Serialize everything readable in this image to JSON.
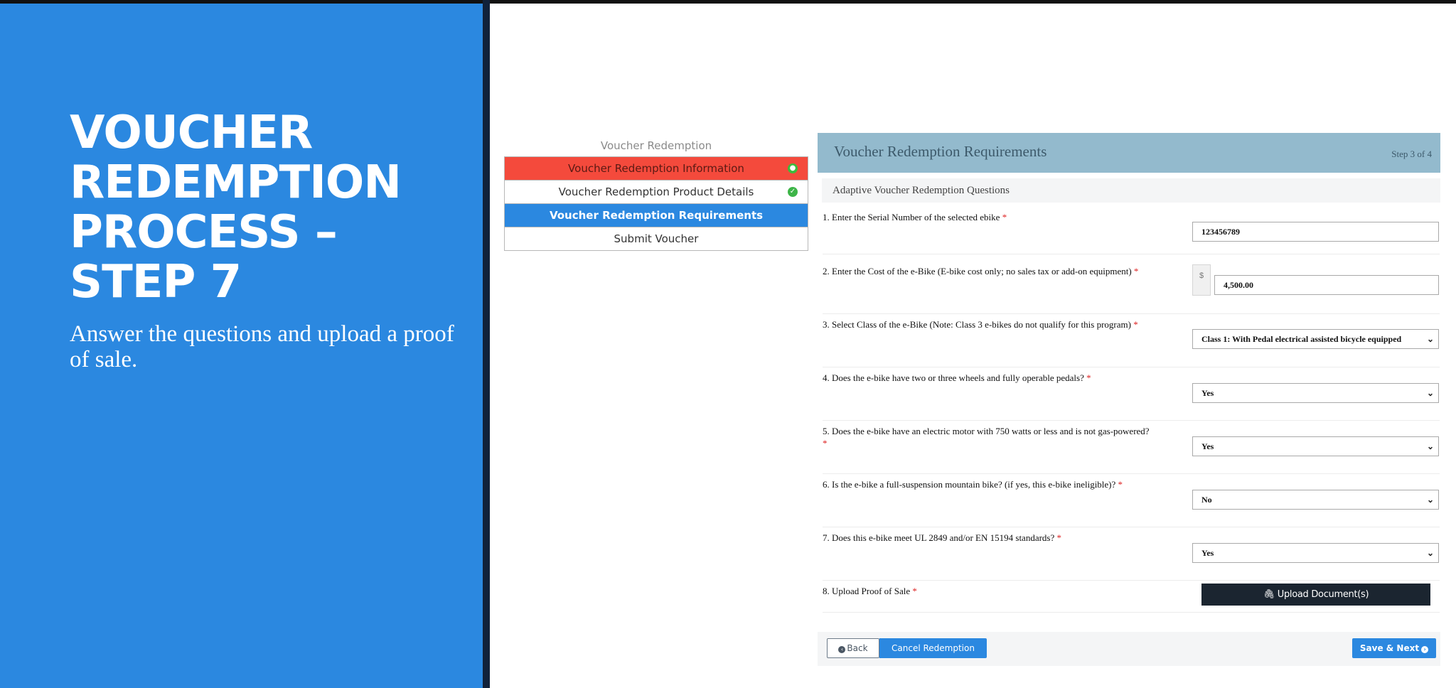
{
  "slide": {
    "title_lines": [
      "VOUCHER",
      "REDEMPTION",
      "PROCESS –",
      "STEP 7"
    ],
    "subtitle": "Answer the questions and upload a proof of sale."
  },
  "steps_nav": {
    "header": "Voucher Redemption",
    "items": [
      {
        "label": "Voucher Redemption Information",
        "state": "error",
        "check": "●"
      },
      {
        "label": "Voucher Redemption Product Details",
        "state": "complete",
        "check": "✓"
      },
      {
        "label": "Voucher Redemption Requirements",
        "state": "active"
      },
      {
        "label": "Submit Voucher",
        "state": "pending"
      }
    ]
  },
  "form": {
    "title": "Voucher Redemption Requirements",
    "step_indicator": "Step 3 of 4",
    "section_title": "Adaptive Voucher Redemption Questions",
    "currency_symbol": "$",
    "questions": [
      {
        "label": "1. Enter the Serial Number of the selected ebike",
        "value": "123456789"
      },
      {
        "label": "2. Enter the Cost of the e-Bike (E-bike cost only; no sales tax or add-on equipment)",
        "value": "4,500.00"
      },
      {
        "label": "3. Select Class of the e-Bike (Note: Class 3 e-bikes do not qualify for this program)",
        "value": "Class 1: With Pedal electrical assisted bicycle equipped"
      },
      {
        "label": "4. Does the e-bike have two or three wheels and fully operable pedals?",
        "value": "Yes"
      },
      {
        "label": "5. Does the e-bike have an electric motor with 750 watts or less and is not gas-powered?",
        "value": "Yes"
      },
      {
        "label": "6. Is the e-bike a full-suspension mountain bike? (if yes, this e-bike ineligible)?",
        "value": "No"
      },
      {
        "label": "7. Does this e-bike meet UL 2849 and/or EN 15194 standards?",
        "value": "Yes"
      },
      {
        "label": "8. Upload Proof of Sale"
      }
    ],
    "required_marker": "*",
    "upload_label": "Upload Document(s)",
    "buttons": {
      "back": "Back",
      "cancel": "Cancel Redemption",
      "save_next": "Save & Next"
    }
  },
  "colors": {
    "slide_blue": "#2b88e0",
    "error_red": "#f44a3c",
    "header_blue_gray": "#93bacd",
    "upload_dark": "#1b2530"
  },
  "icons": {
    "back": "circle-chevron-left-icon",
    "save_next": "circle-chevron-right-icon",
    "upload": "paperclip-icon",
    "check": "check-circle-icon",
    "select": "chevron-down-icon"
  }
}
